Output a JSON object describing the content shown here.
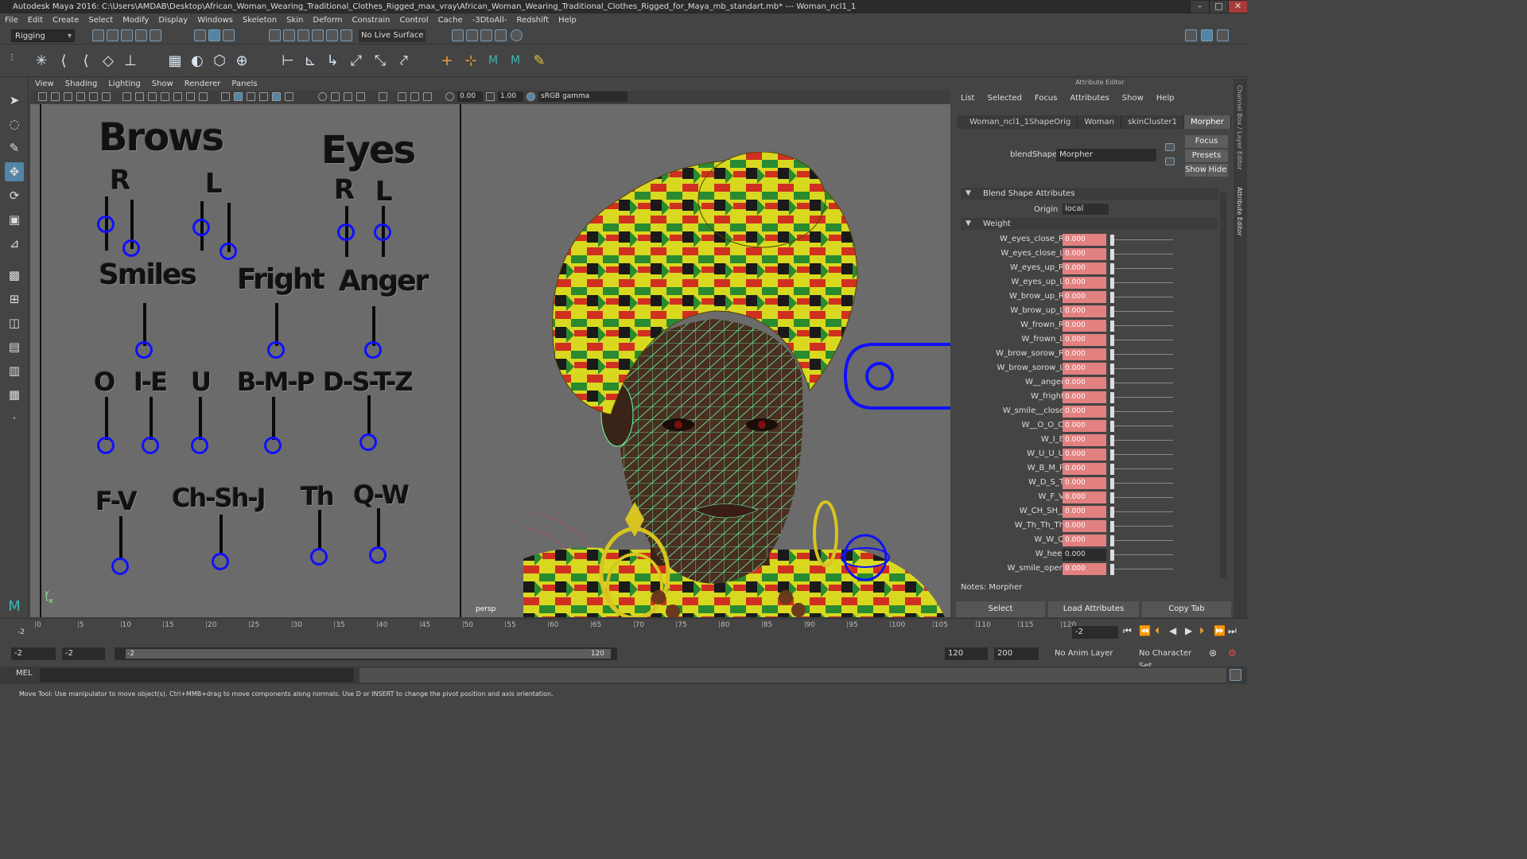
{
  "window": {
    "title": "Autodesk Maya 2016: C:\\Users\\AMDAB\\Desktop\\African_Woman_Wearing_Traditional_Clothes_Rigged_max_vray\\African_Woman_Wearing_Traditional_Clothes_Rigged_for_Maya_mb_standart.mb*   ---   Woman_ncl1_1"
  },
  "menu": [
    "File",
    "Edit",
    "Create",
    "Select",
    "Modify",
    "Display",
    "Windows",
    "Skeleton",
    "Skin",
    "Deform",
    "Constrain",
    "Control",
    "Cache",
    "-3DtoAll-",
    "Redshift",
    "Help"
  ],
  "status": {
    "mode": "Rigging",
    "live_surface": "No Live Surface"
  },
  "panel_menu": [
    "View",
    "Shading",
    "Lighting",
    "Show",
    "Renderer",
    "Panels"
  ],
  "panel_toolbar": {
    "exposure": "0.00",
    "gamma": "1.00",
    "color_space": "sRGB gamma"
  },
  "board": {
    "brows": "Brows",
    "eyes": "Eyes",
    "R": "R",
    "L": "L",
    "smiles": "Smiles",
    "fright": "Fright",
    "anger": "Anger",
    "o": "O",
    "ie": "I-E",
    "u": "U",
    "bmp": "B-M-P",
    "dstz": "D-S-T-Z",
    "fv": "F-V",
    "chshj": "Ch-Sh-J",
    "th": "Th",
    "qw": "Q-W"
  },
  "viewport": {
    "camera": "persp"
  },
  "attr_editor": {
    "title": "Attribute Editor",
    "menu": [
      "List",
      "Selected",
      "Focus",
      "Attributes",
      "Show",
      "Help"
    ],
    "tabs": [
      "Woman_ncl1_1ShapeOrig",
      "Woman",
      "skinCluster1",
      "Morpher"
    ],
    "blendshape_label": "blendShape:",
    "blendshape_value": "Morpher",
    "focus": "Focus",
    "presets": "Presets",
    "show": "Show",
    "hide": "Hide",
    "section_blend": "Blend Shape Attributes",
    "origin_label": "Origin",
    "origin_value": "local",
    "section_weight": "Weight",
    "weights": [
      {
        "name": "W_eyes_close_R",
        "value": "0.000"
      },
      {
        "name": "W_eyes_close_L",
        "value": "0.000"
      },
      {
        "name": "W_eyes_up_R",
        "value": "0.000"
      },
      {
        "name": "W_eyes_up_L",
        "value": "0.000"
      },
      {
        "name": "W_brow_up_R",
        "value": "0.000"
      },
      {
        "name": "W_brow_up_L",
        "value": "0.000"
      },
      {
        "name": "W_frown_R",
        "value": "0.000"
      },
      {
        "name": "W_frown_L",
        "value": "0.000"
      },
      {
        "name": "W_brow_sorow_R",
        "value": "0.000"
      },
      {
        "name": "W_brow_sorow_L",
        "value": "0.000"
      },
      {
        "name": "W__anger",
        "value": "0.000"
      },
      {
        "name": "W_fright",
        "value": "0.000"
      },
      {
        "name": "W_smile__close",
        "value": "0.000"
      },
      {
        "name": "W__O_O_O",
        "value": "0.000"
      },
      {
        "name": "W_I_E",
        "value": "0.000"
      },
      {
        "name": "W_U_U_U",
        "value": "0.000"
      },
      {
        "name": "W_B_M_P",
        "value": "0.000"
      },
      {
        "name": "W_D_S_T",
        "value": "0.000"
      },
      {
        "name": "W_F_V",
        "value": "0.000"
      },
      {
        "name": "W_CH_SH_J",
        "value": "0.000"
      },
      {
        "name": "W_Th_Th_Th",
        "value": "0.000"
      },
      {
        "name": "W_W_Q",
        "value": "0.000"
      },
      {
        "name": "W_heel",
        "value": "0.000"
      },
      {
        "name": "W_smile_open",
        "value": "0.000"
      }
    ],
    "notes": "Notes:  Morpher",
    "select": "Select",
    "load": "Load Attributes",
    "copy": "Copy Tab"
  },
  "side_tabs": {
    "channel": "Channel Box / Layer Editor",
    "attr": "Attribute Editor"
  },
  "timeline": {
    "ticks": [
      "0",
      "5",
      "10",
      "15",
      "20",
      "25",
      "30",
      "35",
      "40",
      "45",
      "50",
      "55",
      "60",
      "65",
      "70",
      "75",
      "80",
      "85",
      "90",
      "95",
      "100",
      "105",
      "110",
      "115",
      "120"
    ],
    "current": "-2",
    "start_marker": "-2"
  },
  "range": {
    "start": "-2",
    "anim_start": "-2",
    "bar_start": "-2",
    "bar_end": "120",
    "end": "120",
    "anim_end": "200",
    "anim_layer": "No Anim Layer",
    "char_set": "No Character Set"
  },
  "cmd": {
    "label": "MEL"
  },
  "help": "Move Tool: Use manipulator to move object(s). Ctrl+MMB+drag to move components along normals. Use D or INSERT to change the pivot position and axis orientation.",
  "colors": {
    "weight_field": "#e38080",
    "knob": "#1010ff",
    "wire": "#66ffaa",
    "accent": "#5285a6"
  }
}
